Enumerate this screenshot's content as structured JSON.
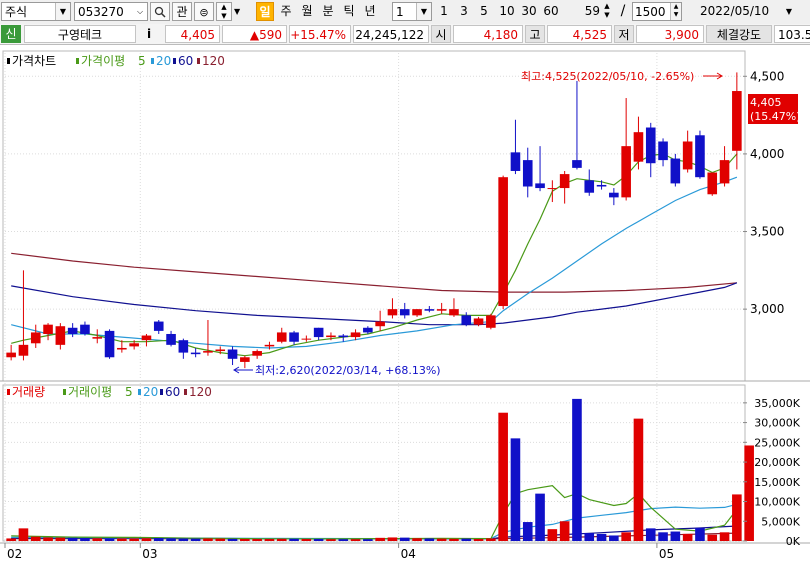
{
  "toolbar": {
    "market_type": "주식",
    "stock_code": "053270",
    "favorite_btn": "관",
    "period_buttons": [
      "일",
      "주",
      "월",
      "분",
      "틱",
      "년"
    ],
    "active_period": "일",
    "interval_select": "1",
    "interval_buttons": [
      "1",
      "3",
      "5",
      "10",
      "30",
      "60"
    ],
    "bar_count": "59",
    "bar_total": "1500",
    "separator": "/",
    "date": "2022/05/10"
  },
  "info": {
    "tag": "신",
    "name": "구영테크",
    "info_btn": "i",
    "price": "4,405",
    "change": "▲590",
    "change_pct": "+15.47%",
    "volume": "24,245,122",
    "open_label": "시",
    "open": "4,180",
    "high_label": "고",
    "high": "4,525",
    "low_label": "저",
    "low": "3,900",
    "strength_label": "체결강도",
    "strength": "103.5"
  },
  "price_legend": {
    "title": "가격차트",
    "ma_label": "가격이평",
    "ma": [
      "5",
      "20",
      "60",
      "120"
    ]
  },
  "volume_legend": {
    "title": "거래량",
    "ma_label": "거래이평",
    "ma": [
      "5",
      "20",
      "60",
      "120"
    ]
  },
  "colors": {
    "up": "#e00000",
    "down": "#1010c8",
    "ma5": "#4a9a18",
    "ma20": "#2a9ad8",
    "ma60": "#101090",
    "ma120": "#8a2030",
    "grid": "#dcdcdc"
  },
  "annotations": {
    "high": "최고:4,525(2022/05/10, -2.65%)",
    "low": "최저:2,620(2022/03/14, +68.13%)",
    "last_price": "4,405",
    "last_pct": "(15.47%)"
  },
  "chart_data": {
    "type": "candlestick",
    "price_axis": {
      "ticks": [
        3000,
        3500,
        4000,
        4500
      ],
      "labels": [
        "3,000",
        "3,500",
        "4,000",
        "4,500"
      ],
      "range": [
        2550,
        4650
      ]
    },
    "volume_axis": {
      "ticks": [
        0,
        5000,
        10000,
        15000,
        20000,
        25000,
        30000,
        35000
      ],
      "labels": [
        "0K",
        "5,000K",
        "10,000K",
        "15,000K",
        "20,000K",
        "25,000K",
        "30,000K",
        "35,000K"
      ],
      "range": [
        0,
        38000
      ]
    },
    "x_labels": [
      {
        "index": 0,
        "label": "02"
      },
      {
        "index": 11,
        "label": "03"
      },
      {
        "index": 32,
        "label": "04"
      },
      {
        "index": 53,
        "label": "05"
      }
    ],
    "candles": [
      {
        "o": 2690,
        "h": 2770,
        "l": 2670,
        "c": 2720
      },
      {
        "o": 2700,
        "h": 3250,
        "l": 2670,
        "c": 2770
      },
      {
        "o": 2780,
        "h": 2900,
        "l": 2750,
        "c": 2850
      },
      {
        "o": 2840,
        "h": 2910,
        "l": 2800,
        "c": 2900
      },
      {
        "o": 2770,
        "h": 2910,
        "l": 2740,
        "c": 2890
      },
      {
        "o": 2880,
        "h": 2910,
        "l": 2820,
        "c": 2840
      },
      {
        "o": 2900,
        "h": 2920,
        "l": 2830,
        "c": 2840
      },
      {
        "o": 2810,
        "h": 2870,
        "l": 2780,
        "c": 2820
      },
      {
        "o": 2860,
        "h": 2870,
        "l": 2680,
        "c": 2690
      },
      {
        "o": 2740,
        "h": 2800,
        "l": 2720,
        "c": 2750
      },
      {
        "o": 2760,
        "h": 2800,
        "l": 2740,
        "c": 2780
      },
      {
        "o": 2800,
        "h": 2840,
        "l": 2760,
        "c": 2830
      },
      {
        "o": 2920,
        "h": 2930,
        "l": 2840,
        "c": 2860
      },
      {
        "o": 2840,
        "h": 2860,
        "l": 2760,
        "c": 2770
      },
      {
        "o": 2800,
        "h": 2810,
        "l": 2680,
        "c": 2720
      },
      {
        "o": 2720,
        "h": 2750,
        "l": 2690,
        "c": 2710
      },
      {
        "o": 2720,
        "h": 2930,
        "l": 2700,
        "c": 2730
      },
      {
        "o": 2730,
        "h": 2760,
        "l": 2710,
        "c": 2740
      },
      {
        "o": 2740,
        "h": 2760,
        "l": 2640,
        "c": 2680
      },
      {
        "o": 2660,
        "h": 2700,
        "l": 2620,
        "c": 2690
      },
      {
        "o": 2700,
        "h": 2740,
        "l": 2680,
        "c": 2730
      },
      {
        "o": 2760,
        "h": 2790,
        "l": 2740,
        "c": 2770
      },
      {
        "o": 2790,
        "h": 2880,
        "l": 2780,
        "c": 2850
      },
      {
        "o": 2850,
        "h": 2860,
        "l": 2770,
        "c": 2790
      },
      {
        "o": 2810,
        "h": 2830,
        "l": 2790,
        "c": 2810
      },
      {
        "o": 2880,
        "h": 2880,
        "l": 2800,
        "c": 2820
      },
      {
        "o": 2820,
        "h": 2850,
        "l": 2800,
        "c": 2830
      },
      {
        "o": 2830,
        "h": 2840,
        "l": 2790,
        "c": 2820
      },
      {
        "o": 2820,
        "h": 2870,
        "l": 2800,
        "c": 2850
      },
      {
        "o": 2880,
        "h": 2890,
        "l": 2840,
        "c": 2850
      },
      {
        "o": 2890,
        "h": 2990,
        "l": 2860,
        "c": 2920
      },
      {
        "o": 2960,
        "h": 3070,
        "l": 2940,
        "c": 3000
      },
      {
        "o": 3000,
        "h": 3040,
        "l": 2940,
        "c": 2960
      },
      {
        "o": 2960,
        "h": 3000,
        "l": 2950,
        "c": 3000
      },
      {
        "o": 3000,
        "h": 3020,
        "l": 2980,
        "c": 2990
      },
      {
        "o": 2990,
        "h": 3040,
        "l": 2970,
        "c": 3000
      },
      {
        "o": 2960,
        "h": 3070,
        "l": 2950,
        "c": 3000
      },
      {
        "o": 2960,
        "h": 2980,
        "l": 2890,
        "c": 2900
      },
      {
        "o": 2900,
        "h": 2950,
        "l": 2890,
        "c": 2940
      },
      {
        "o": 2880,
        "h": 2970,
        "l": 2870,
        "c": 2960
      },
      {
        "o": 3020,
        "h": 3860,
        "l": 3000,
        "c": 3850
      },
      {
        "o": 4010,
        "h": 4220,
        "l": 3870,
        "c": 3890
      },
      {
        "o": 3960,
        "h": 4040,
        "l": 3720,
        "c": 3790
      },
      {
        "o": 3810,
        "h": 4050,
        "l": 3760,
        "c": 3780
      },
      {
        "o": 3780,
        "h": 3830,
        "l": 3690,
        "c": 3780
      },
      {
        "o": 3780,
        "h": 3890,
        "l": 3680,
        "c": 3870
      },
      {
        "o": 3960,
        "h": 4470,
        "l": 3900,
        "c": 3910
      },
      {
        "o": 3830,
        "h": 3900,
        "l": 3730,
        "c": 3750
      },
      {
        "o": 3800,
        "h": 3830,
        "l": 3770,
        "c": 3790
      },
      {
        "o": 3750,
        "h": 3780,
        "l": 3670,
        "c": 3720
      },
      {
        "o": 3720,
        "h": 4360,
        "l": 3700,
        "c": 4050
      },
      {
        "o": 3950,
        "h": 4240,
        "l": 3900,
        "c": 4140
      },
      {
        "o": 4170,
        "h": 4200,
        "l": 3850,
        "c": 3940
      },
      {
        "o": 4080,
        "h": 4100,
        "l": 3920,
        "c": 3960
      },
      {
        "o": 3970,
        "h": 4000,
        "l": 3790,
        "c": 3810
      },
      {
        "o": 3900,
        "h": 4150,
        "l": 3880,
        "c": 4080
      },
      {
        "o": 4120,
        "h": 4150,
        "l": 3840,
        "c": 3850
      },
      {
        "o": 3740,
        "h": 3880,
        "l": 3730,
        "c": 3880
      },
      {
        "o": 3810,
        "h": 4050,
        "l": 3790,
        "c": 3960
      },
      {
        "o": 4020,
        "h": 4525,
        "l": 3900,
        "c": 4405
      }
    ],
    "volumes": [
      650,
      3200,
      1100,
      900,
      850,
      800,
      750,
      700,
      650,
      650,
      650,
      700,
      750,
      700,
      650,
      600,
      650,
      600,
      550,
      500,
      500,
      500,
      550,
      550,
      500,
      500,
      450,
      450,
      450,
      450,
      800,
      900,
      850,
      700,
      650,
      600,
      550,
      600,
      500,
      650,
      32500,
      26000,
      4800,
      12000,
      3000,
      5000,
      36000,
      2000,
      1800,
      1400,
      2200,
      31000,
      3200,
      2200,
      2400,
      1800,
      3300,
      1600,
      2200,
      11800,
      24200
    ],
    "ma_price": {
      "ma5": [
        [
          0,
          2780
        ],
        [
          1,
          2800
        ],
        [
          3,
          2830
        ],
        [
          5,
          2860
        ],
        [
          7,
          2830
        ],
        [
          9,
          2790
        ],
        [
          11,
          2790
        ],
        [
          13,
          2800
        ],
        [
          15,
          2750
        ],
        [
          17,
          2720
        ],
        [
          19,
          2700
        ],
        [
          21,
          2720
        ],
        [
          23,
          2770
        ],
        [
          25,
          2800
        ],
        [
          27,
          2820
        ],
        [
          29,
          2840
        ],
        [
          31,
          2880
        ],
        [
          33,
          2930
        ],
        [
          35,
          2970
        ],
        [
          37,
          2960
        ],
        [
          39,
          2960
        ],
        [
          40,
          3100
        ],
        [
          41,
          3250
        ],
        [
          42,
          3420
        ],
        [
          43,
          3580
        ],
        [
          44,
          3760
        ],
        [
          45,
          3810
        ],
        [
          46,
          3840
        ],
        [
          47,
          3830
        ],
        [
          48,
          3820
        ],
        [
          49,
          3800
        ],
        [
          50,
          3860
        ],
        [
          51,
          3950
        ],
        [
          52,
          3990
        ],
        [
          53,
          4000
        ],
        [
          54,
          3960
        ],
        [
          55,
          3950
        ],
        [
          56,
          3920
        ],
        [
          57,
          3880
        ],
        [
          58,
          3910
        ],
        [
          59,
          4000
        ]
      ],
      "ma20": [
        [
          0,
          2900
        ],
        [
          3,
          2840
        ],
        [
          6,
          2840
        ],
        [
          9,
          2820
        ],
        [
          12,
          2800
        ],
        [
          15,
          2780
        ],
        [
          18,
          2760
        ],
        [
          21,
          2750
        ],
        [
          24,
          2760
        ],
        [
          27,
          2790
        ],
        [
          30,
          2830
        ],
        [
          33,
          2860
        ],
        [
          36,
          2900
        ],
        [
          39,
          2920
        ],
        [
          40,
          2990
        ],
        [
          42,
          3100
        ],
        [
          44,
          3200
        ],
        [
          46,
          3310
        ],
        [
          48,
          3420
        ],
        [
          50,
          3520
        ],
        [
          52,
          3610
        ],
        [
          54,
          3700
        ],
        [
          56,
          3770
        ],
        [
          58,
          3820
        ],
        [
          59,
          3850
        ]
      ],
      "ma60": [
        [
          0,
          3150
        ],
        [
          5,
          3080
        ],
        [
          10,
          3030
        ],
        [
          15,
          2990
        ],
        [
          20,
          2960
        ],
        [
          25,
          2940
        ],
        [
          30,
          2920
        ],
        [
          34,
          2900
        ],
        [
          38,
          2900
        ],
        [
          40,
          2910
        ],
        [
          42,
          2930
        ],
        [
          44,
          2950
        ],
        [
          46,
          2980
        ],
        [
          48,
          3000
        ],
        [
          50,
          3020
        ],
        [
          52,
          3050
        ],
        [
          54,
          3080
        ],
        [
          56,
          3110
        ],
        [
          58,
          3140
        ],
        [
          59,
          3170
        ]
      ],
      "ma120": [
        [
          0,
          3360
        ],
        [
          5,
          3310
        ],
        [
          10,
          3270
        ],
        [
          15,
          3240
        ],
        [
          20,
          3210
        ],
        [
          25,
          3180
        ],
        [
          30,
          3150
        ],
        [
          35,
          3120
        ],
        [
          40,
          3110
        ],
        [
          45,
          3110
        ],
        [
          50,
          3120
        ],
        [
          55,
          3140
        ],
        [
          59,
          3170
        ]
      ]
    },
    "ma_volume": {
      "ma5": [
        [
          0,
          1300
        ],
        [
          5,
          1000
        ],
        [
          10,
          900
        ],
        [
          15,
          700
        ],
        [
          20,
          550
        ],
        [
          25,
          500
        ],
        [
          30,
          600
        ],
        [
          35,
          650
        ],
        [
          39,
          620
        ],
        [
          40,
          6800
        ],
        [
          41,
          12000
        ],
        [
          42,
          13000
        ],
        [
          44,
          14000
        ],
        [
          45,
          11000
        ],
        [
          46,
          12000
        ],
        [
          47,
          10500
        ],
        [
          49,
          9000
        ],
        [
          50,
          9500
        ],
        [
          51,
          12000
        ],
        [
          52,
          8500
        ],
        [
          54,
          3000
        ],
        [
          56,
          2500
        ],
        [
          58,
          4000
        ],
        [
          59,
          8000
        ]
      ],
      "ma20": [
        [
          0,
          900
        ],
        [
          10,
          800
        ],
        [
          20,
          650
        ],
        [
          30,
          600
        ],
        [
          39,
          600
        ],
        [
          40,
          2200
        ],
        [
          42,
          3500
        ],
        [
          44,
          4200
        ],
        [
          46,
          5800
        ],
        [
          48,
          6500
        ],
        [
          50,
          7200
        ],
        [
          52,
          8200
        ],
        [
          54,
          8600
        ],
        [
          56,
          8300
        ],
        [
          58,
          8500
        ],
        [
          59,
          9300
        ]
      ],
      "ma60": [
        [
          0,
          700
        ],
        [
          10,
          650
        ],
        [
          20,
          600
        ],
        [
          30,
          550
        ],
        [
          39,
          550
        ],
        [
          40,
          1000
        ],
        [
          44,
          1500
        ],
        [
          48,
          2100
        ],
        [
          52,
          2800
        ],
        [
          56,
          3300
        ],
        [
          59,
          3800
        ]
      ],
      "ma120": [
        [
          0,
          600
        ],
        [
          20,
          550
        ],
        [
          39,
          550
        ],
        [
          42,
          700
        ],
        [
          46,
          1000
        ],
        [
          50,
          1300
        ],
        [
          54,
          1600
        ],
        [
          59,
          2000
        ]
      ]
    }
  }
}
